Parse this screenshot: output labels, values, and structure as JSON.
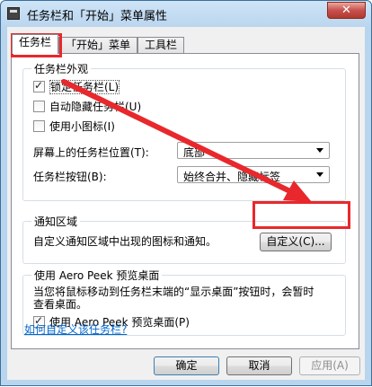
{
  "window": {
    "title": "任务栏和「开始」菜单属性",
    "close_label": "✕"
  },
  "tabs": [
    {
      "label": "任务栏",
      "active": true
    },
    {
      "label": "「开始」菜单",
      "active": false
    },
    {
      "label": "工具栏",
      "active": false
    }
  ],
  "appearance": {
    "group_title": "任务栏外观",
    "lock_taskbar": {
      "label": "锁定任务栏(L)",
      "checked": true
    },
    "autohide": {
      "label": "自动隐藏任务栏(U)",
      "checked": false
    },
    "small_icons": {
      "label": "使用小图标(I)",
      "checked": false
    },
    "location": {
      "label": "屏幕上的任务栏位置(T):",
      "value": "底部"
    },
    "buttons": {
      "label": "任务栏按钮(B):",
      "value": "始终合并、隐藏标签"
    }
  },
  "notification": {
    "group_title": "通知区域",
    "description": "自定义通知区域中出现的图标和通知。",
    "customize_button": "自定义(C)..."
  },
  "aero_peek": {
    "group_title": "使用 Aero Peek 预览桌面",
    "description_line1": "当您将鼠标移动到任务栏末端的“显示桌面”按钮时，会暂时",
    "description_line2": "查看桌面。",
    "use_peek": {
      "label": "使用 Aero Peek 预览桌面(P)",
      "checked": true
    }
  },
  "help_link": "如何自定义该任务栏?",
  "footer": {
    "ok": "确定",
    "cancel": "取消",
    "apply": "应用(A)"
  },
  "colors": {
    "annotation_red": "#e8282c",
    "link": "#0066cc"
  }
}
